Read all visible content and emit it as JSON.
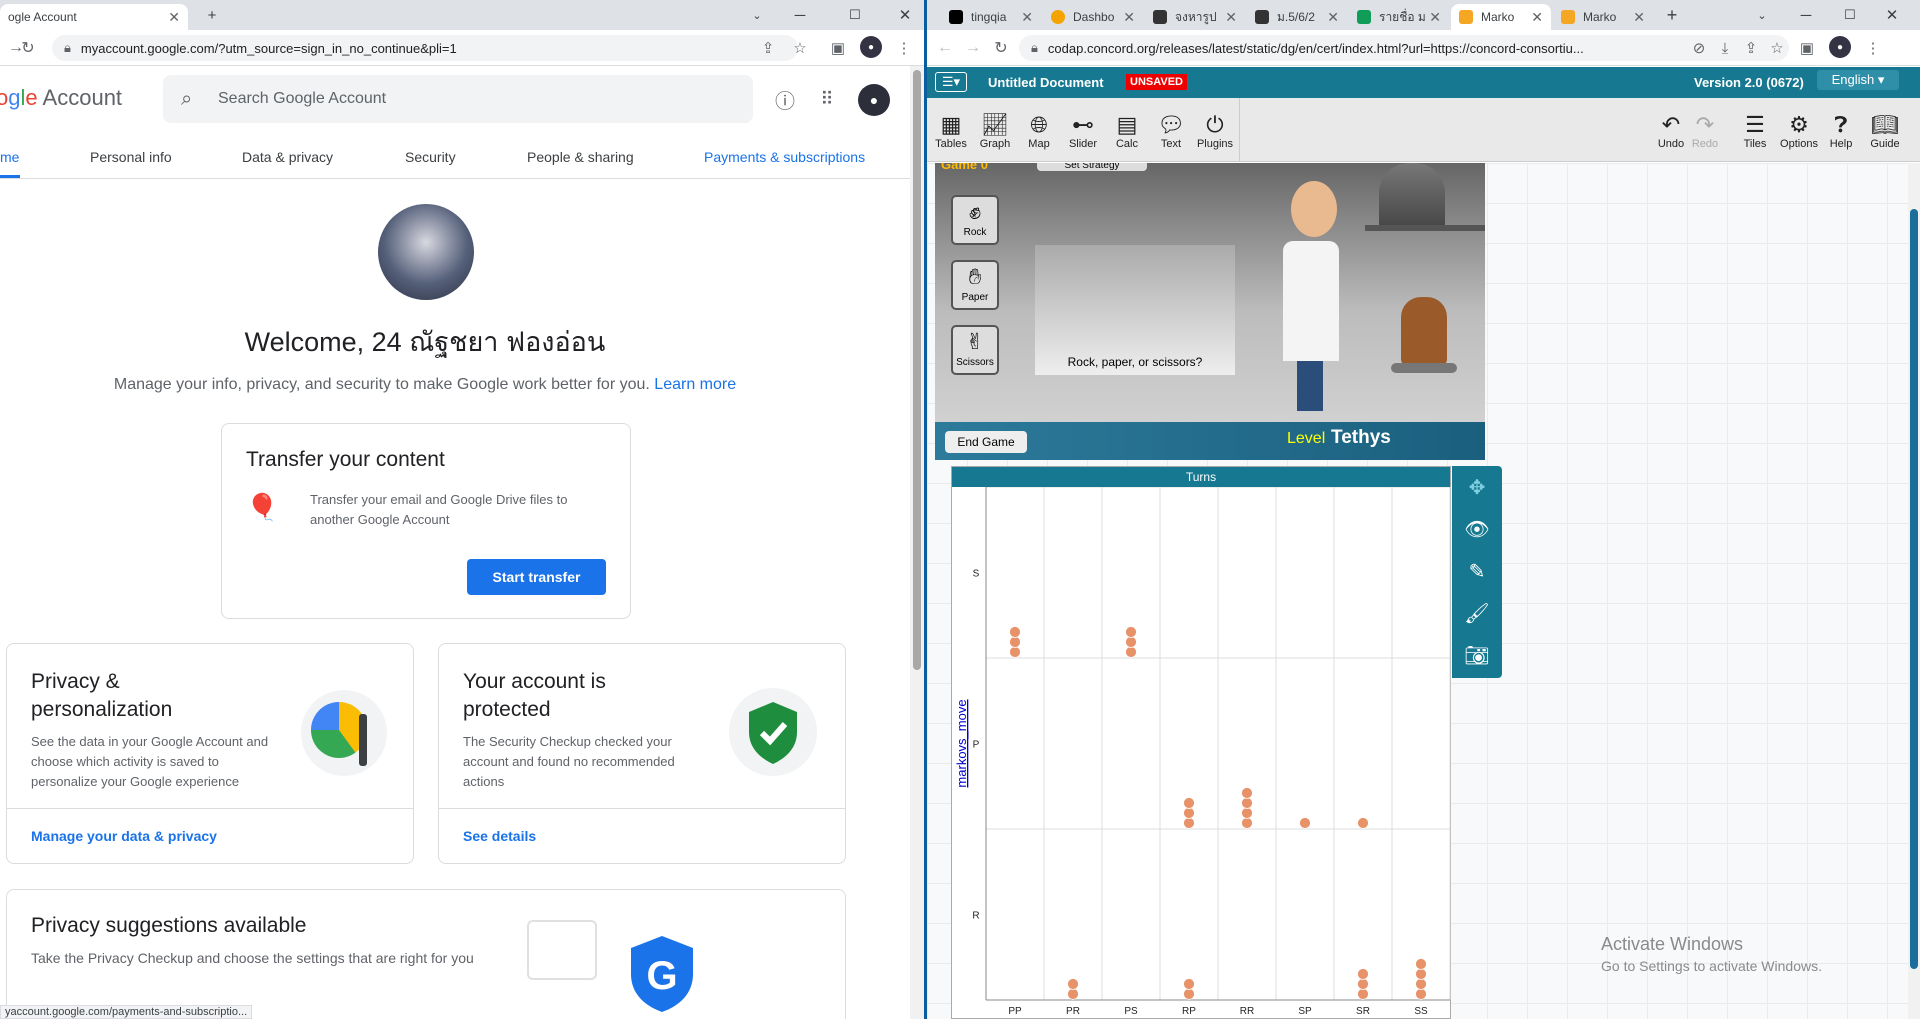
{
  "left_browser": {
    "tab_title": "ogle Account",
    "url": "myaccount.google.com/?utm_source=sign_in_no_continue&pli=1",
    "status_url": "yaccount.google.com/payments-and-subscriptio..."
  },
  "google_account": {
    "logo_text": "ogle Account",
    "search_placeholder": "Search Google Account",
    "nav_tabs": [
      "me",
      "Personal info",
      "Data & privacy",
      "Security",
      "People & sharing",
      "Payments & subscriptions"
    ],
    "welcome": "Welcome, 24 ณัฐชยา ฟองอ่อน",
    "subtitle": "Manage your info, privacy, and security to make Google work better for you.",
    "learn_more": "Learn more",
    "transfer": {
      "title": "Transfer your content",
      "text": "Transfer your email and Google Drive files to another Google Account",
      "button": "Start transfer"
    },
    "privacy_card": {
      "title": "Privacy & personalization",
      "text": "See the data in your Google Account and choose which activity is saved to personalize your Google experience",
      "link": "Manage your data & privacy"
    },
    "security_card": {
      "title": "Your account is protected",
      "text": "The Security Checkup checked your account and found no recommended actions",
      "link": "See details"
    },
    "suggestions": {
      "title": "Privacy suggestions available",
      "text": "Take the Privacy Checkup and choose the settings that are right for you"
    }
  },
  "right_browser": {
    "tabs": [
      "tingqia",
      "Dashbo",
      "จงหารูป",
      "ม.5/6/2",
      "รายชื่อ ม",
      "Marko",
      "Marko"
    ],
    "url": "codap.concord.org/releases/latest/static/dg/en/cert/index.html?url=https://concord-consortiu..."
  },
  "codap": {
    "doc_title": "Untitled Document",
    "unsaved": "UNSAVED",
    "version": "Version 2.0 (0672)",
    "language": "English",
    "tools": [
      "Tables",
      "Graph",
      "Map",
      "Slider",
      "Calc",
      "Text",
      "Plugins"
    ],
    "right_tools": [
      "Undo",
      "Redo",
      "Tiles",
      "Options",
      "Help",
      "Guide"
    ],
    "game": {
      "header_fragment": "Game 0",
      "strategy_btn": "Set Strategy",
      "choices": [
        "Rock",
        "Paper",
        "Scissors"
      ],
      "prompt": "Rock, paper, or scissors?",
      "end_game": "End Game",
      "level_label": "Level",
      "level_name": "Tethys"
    },
    "graph_title": "Turns",
    "activate": {
      "title": "Activate Windows",
      "text": "Go to Settings to activate Windows."
    }
  },
  "chart_data": {
    "type": "scatter",
    "title": "Turns",
    "xlabel": "",
    "ylabel": "markovs_move",
    "x_categories": [
      "PP",
      "PR",
      "PS",
      "RP",
      "RR",
      "SP",
      "SR",
      "SS"
    ],
    "y_categories": [
      "R",
      "P",
      "S"
    ],
    "points": [
      {
        "x": "PP",
        "y": "S",
        "count": 3
      },
      {
        "x": "PS",
        "y": "S",
        "count": 3
      },
      {
        "x": "RP",
        "y": "P",
        "count": 3
      },
      {
        "x": "RR",
        "y": "P",
        "count": 4
      },
      {
        "x": "SP",
        "y": "P",
        "count": 1
      },
      {
        "x": "SR",
        "y": "P",
        "count": 1
      },
      {
        "x": "PR",
        "y": "R",
        "count": 2
      },
      {
        "x": "RP",
        "y": "R",
        "count": 2
      },
      {
        "x": "SR",
        "y": "R",
        "count": 3
      },
      {
        "x": "SS",
        "y": "R",
        "count": 4
      }
    ],
    "point_color": "#e8926a"
  }
}
